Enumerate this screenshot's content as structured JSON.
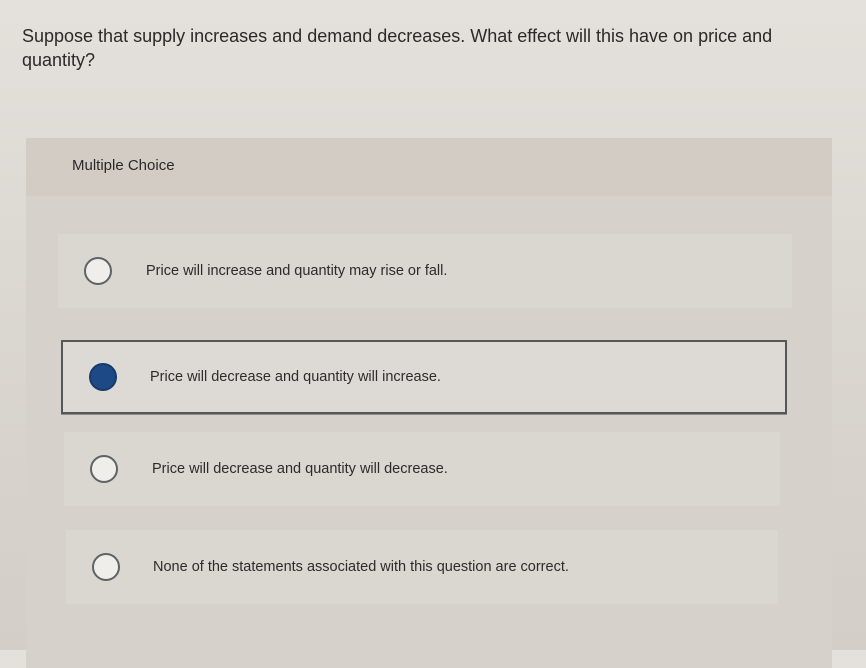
{
  "question": {
    "text": "Suppose that supply increases and demand decreases. What effect will this have on price and quantity?"
  },
  "card": {
    "title": "Multiple Choice"
  },
  "choices": [
    {
      "label": "Price will increase and quantity may rise or fall.",
      "selected": false
    },
    {
      "label": "Price will decrease and quantity will increase.",
      "selected": true
    },
    {
      "label": "Price will decrease and quantity will decrease.",
      "selected": false
    },
    {
      "label": "None of the statements associated with this question are correct.",
      "selected": false
    }
  ],
  "colors": {
    "selected_radio": "#1d4a86",
    "selected_border": "#55585b",
    "background": "#dcd8d2"
  }
}
